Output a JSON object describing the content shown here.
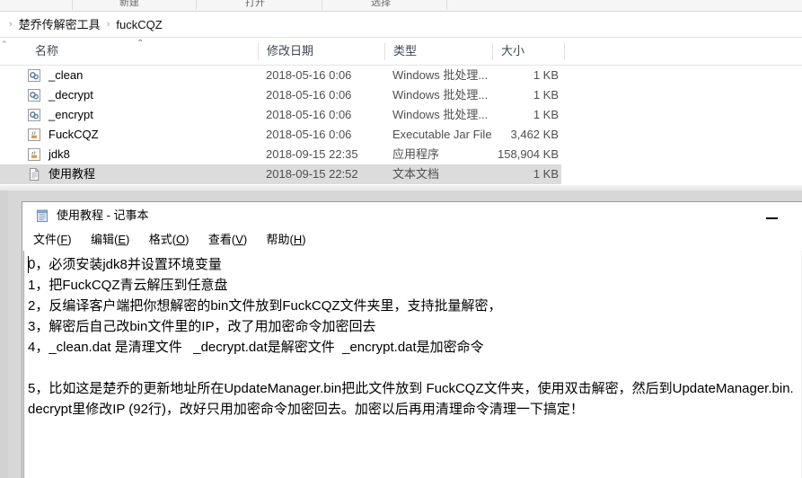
{
  "explorer": {
    "ribbon": {
      "groups": [
        {
          "label": "新建"
        },
        {
          "label": "打开"
        },
        {
          "label": "选择"
        }
      ]
    },
    "breadcrumb": {
      "separator": "›",
      "items": [
        "楚乔传解密工具",
        "fuckCQZ"
      ]
    },
    "columns": [
      {
        "key": "name",
        "label": "名称"
      },
      {
        "key": "date",
        "label": "修改日期"
      },
      {
        "key": "type",
        "label": "类型"
      },
      {
        "key": "size",
        "label": "大小"
      }
    ],
    "sort_indicator": "⌃",
    "files": [
      {
        "icon": "batch-file-icon",
        "name": "_clean",
        "date": "2018-05-16 0:06",
        "type": "Windows 批处理...",
        "size": "1 KB",
        "selected": false
      },
      {
        "icon": "batch-file-icon",
        "name": "_decrypt",
        "date": "2018-05-16 0:06",
        "type": "Windows 批处理...",
        "size": "1 KB",
        "selected": false
      },
      {
        "icon": "batch-file-icon",
        "name": "_encrypt",
        "date": "2018-05-16 0:06",
        "type": "Windows 批处理...",
        "size": "1 KB",
        "selected": false
      },
      {
        "icon": "java-jar-icon",
        "name": "FuckCQZ",
        "date": "2018-05-16 0:06",
        "type": "Executable Jar File",
        "size": "3,462 KB",
        "selected": false
      },
      {
        "icon": "java-app-icon",
        "name": "jdk8",
        "date": "2018-09-15 22:35",
        "type": "应用程序",
        "size": "158,904 KB",
        "selected": false
      },
      {
        "icon": "text-file-icon",
        "name": "使用教程",
        "date": "2018-09-15 22:52",
        "type": "文本文档",
        "size": "1 KB",
        "selected": true
      }
    ],
    "colors": {
      "selection": "#dcdcdc",
      "header_text": "#3c4654",
      "secondary_text": "#4f4f4f"
    }
  },
  "notepad": {
    "title": "使用教程 - 记事本",
    "minimize_label": "—",
    "menu": [
      {
        "label": "文件(F)",
        "pre": "文件(",
        "key": "F",
        "post": ")"
      },
      {
        "label": "编辑(E)",
        "pre": "编辑(",
        "key": "E",
        "post": ")"
      },
      {
        "label": "格式(O)",
        "pre": "格式(",
        "key": "O",
        "post": ")"
      },
      {
        "label": "查看(V)",
        "pre": "查看(",
        "key": "V",
        "post": ")"
      },
      {
        "label": "帮助(H)",
        "pre": "帮助(",
        "key": "H",
        "post": ")"
      }
    ],
    "document_lines": [
      "0，必须安装jdk8并设置环境变量",
      "1，把FuckCQZ青云解压到任意盘",
      "2，反编译客户端把你想解密的bin文件放到FuckCQZ文件夹里，支持批量解密，",
      "3，解密后自己改bin文件里的IP，改了用加密命令加密回去",
      "4，_clean.dat 是清理文件   _decrypt.dat是解密文件  _encrypt.dat是加密命令",
      "",
      "5，比如这是楚乔的更新地址所在UpdateManager.bin把此文件放到 FuckCQZ文件夹，使用双击解密，然后到UpdateManager.bin.decrypt里修改IP (92行)，改好只用加密命令加密回去。加密以后再用清理命令清理一下搞定！"
    ]
  }
}
